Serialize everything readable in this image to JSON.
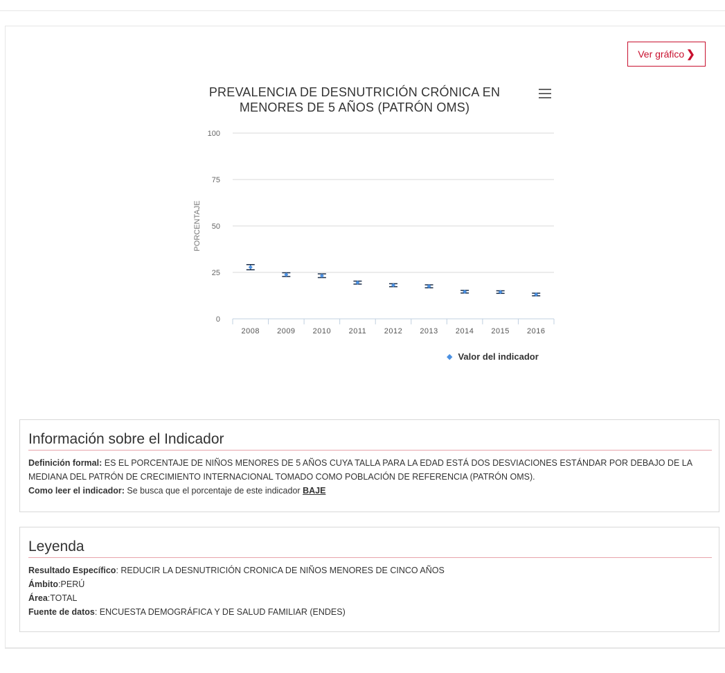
{
  "button": {
    "label": "Ver gráfico",
    "chevron": "❯"
  },
  "menu_icon": "hamburger-menu-icon",
  "legend": {
    "marker": "◆",
    "label": "Valor del indicador"
  },
  "info": {
    "title": "Información sobre el Indicador",
    "def_label": "Definición formal:",
    "def_text": "ES EL PORCENTAJE DE NIÑOS MENORES DE 5 AÑOS CUYA TALLA PARA LA EDAD ESTÁ DOS DESVIACIONES ESTÁNDAR POR DEBAJO DE LA MEDIANA DEL PATRÓN DE CRECIMIENTO INTERNACIONAL TOMADO COMO POBLACIÓN DE REFERENCIA (PATRÓN OMS).",
    "read_label": "Como leer el indicador:",
    "read_text": "Se busca que el porcentaje de este indicador",
    "read_emph": "BAJE"
  },
  "leyenda": {
    "title": "Leyenda",
    "resultado_label": "Resultado Específico",
    "resultado_value": ": REDUCIR LA DESNUTRICIÓN CRONICA DE NIÑOS MENORES DE CINCO AÑOS",
    "ambito_label": "Ámbito",
    "ambito_value": ":PERÚ",
    "area_label": "Área",
    "area_value": ":TOTAL",
    "fuente_label": "Fuente de datos",
    "fuente_value": ": ENCUESTA DEMOGRÁFICA Y DE SALUD FAMILIAR (ENDES)"
  },
  "colors": {
    "accent": "#c8102e",
    "marker": "#4a90e2",
    "errorbar": "#1a2e4a"
  },
  "chart_data": {
    "type": "scatter",
    "title": "PREVALENCIA DE DESNUTRICIÓN CRÓNICA EN MENORES DE 5 AÑOS (PATRÓN OMS)",
    "xlabel": "",
    "ylabel": "PORCENTAJE",
    "ylim": [
      0,
      100
    ],
    "yticks": [
      0,
      25,
      50,
      75,
      100
    ],
    "categories": [
      "2008",
      "2009",
      "2010",
      "2011",
      "2012",
      "2013",
      "2014",
      "2015",
      "2016"
    ],
    "series": [
      {
        "name": "Valor del indicador",
        "values": [
          27.8,
          23.8,
          23.2,
          19.5,
          18.1,
          17.5,
          14.6,
          14.4,
          13.1
        ],
        "error_low": [
          26.4,
          22.8,
          22.2,
          18.7,
          17.3,
          16.7,
          13.9,
          13.7,
          12.4
        ],
        "error_high": [
          29.2,
          24.8,
          24.2,
          20.3,
          18.9,
          18.3,
          15.3,
          15.1,
          13.8
        ]
      }
    ],
    "grid": true,
    "legend_position": "bottom-right"
  }
}
